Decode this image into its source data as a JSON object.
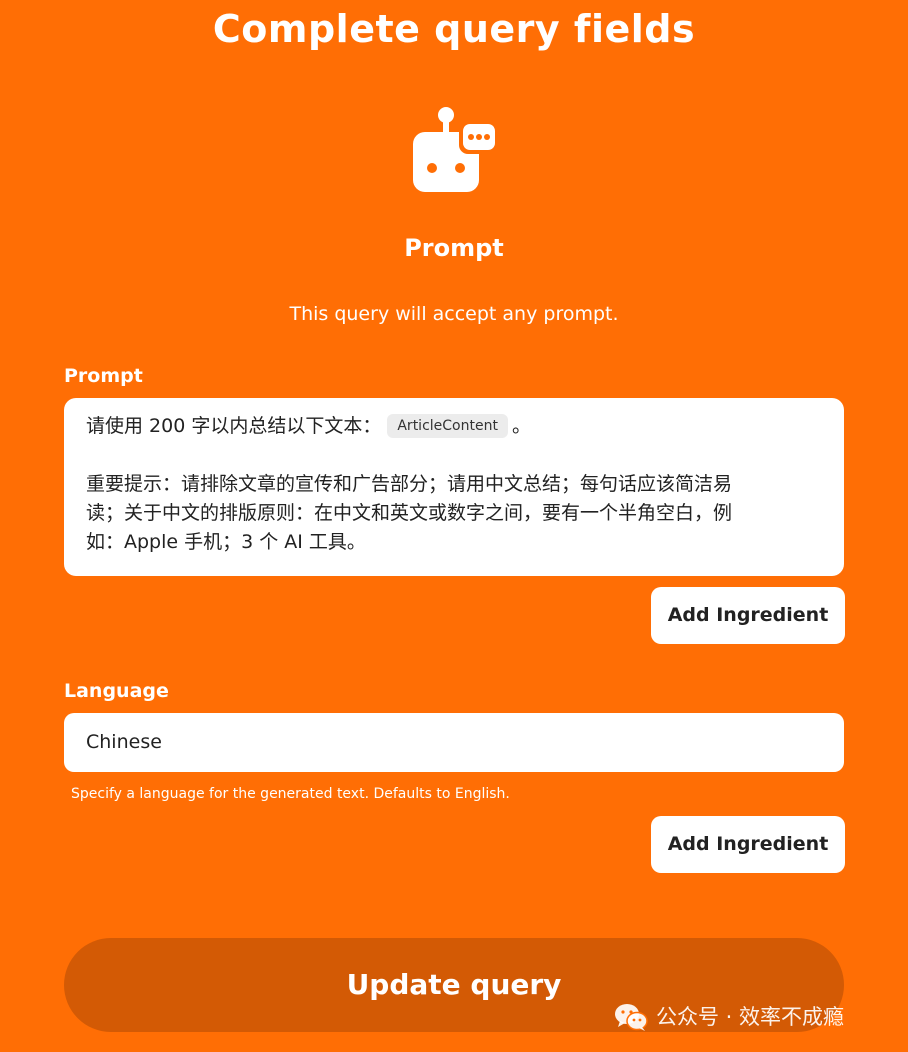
{
  "header": {
    "title": "Complete query fields"
  },
  "service": {
    "icon": "robot-chat-icon",
    "name": "Prompt",
    "description": "This query will accept any prompt."
  },
  "fields": {
    "prompt": {
      "label": "Prompt",
      "text_before_ingredient": "请使用 200 字以内总结以下文本：",
      "ingredient": "ArticleContent",
      "text_after_ingredient": "。",
      "line2": "重要提示：请排除文章的宣传和广告部分；请用中文总结；每句话应该简洁易",
      "line3": "读；关于中文的排版原则：在中文和英文或数字之间，要有一个半角空白，例",
      "line4": "如：Apple 手机；3 个 AI 工具。",
      "add_ingredient_label": "Add Ingredient"
    },
    "language": {
      "label": "Language",
      "value": "Chinese",
      "helper": "Specify a language for the generated text. Defaults to English.",
      "add_ingredient_label": "Add Ingredient"
    }
  },
  "actions": {
    "update_label": "Update query"
  },
  "watermark": {
    "icon": "wechat-icon",
    "text": "公众号 · 效率不成瘾"
  },
  "colors": {
    "background": "#ff6e05",
    "update_button": "#d35a05",
    "pill": "#ececec"
  }
}
